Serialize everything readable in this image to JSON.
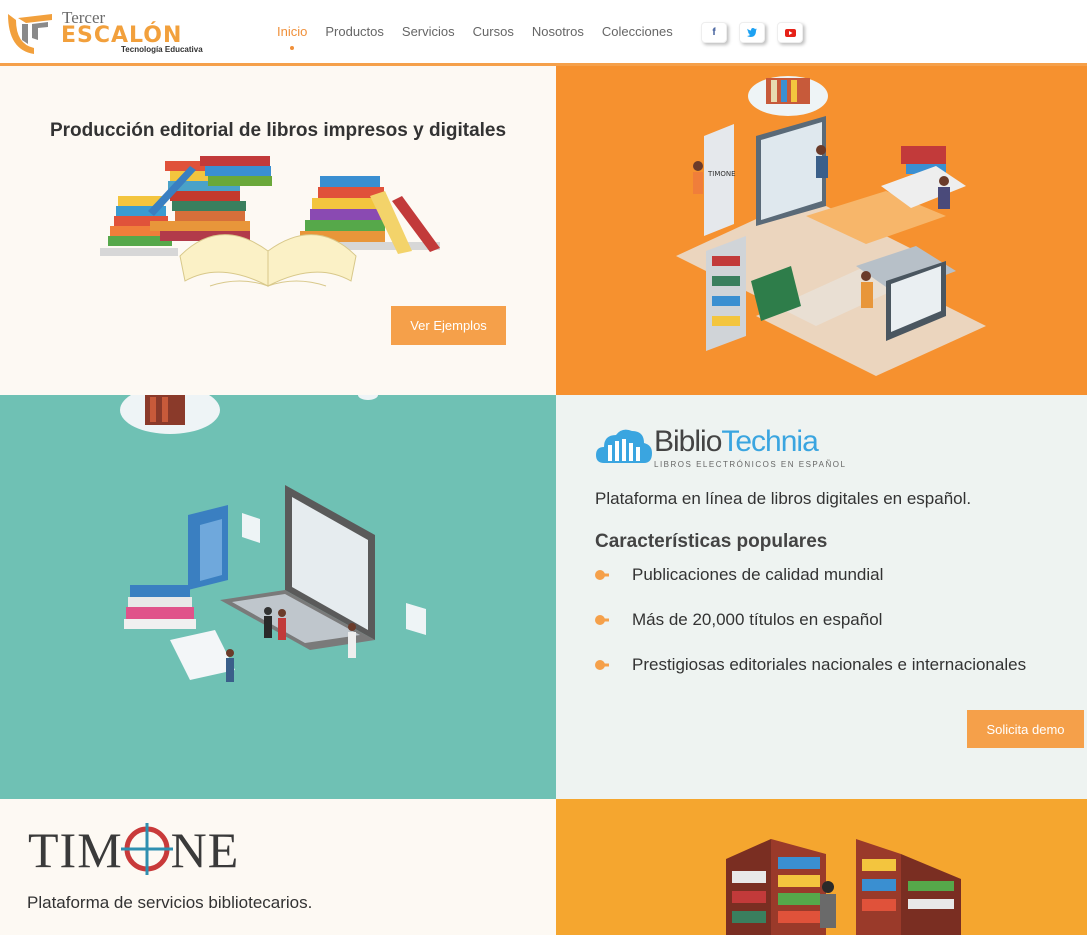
{
  "header": {
    "logo": {
      "top": "Tercer",
      "main": "ESCALÓN",
      "sub": "Tecnología Educativa"
    },
    "nav": [
      {
        "label": "Inicio",
        "active": true
      },
      {
        "label": "Productos",
        "active": false
      },
      {
        "label": "Servicios",
        "active": false
      },
      {
        "label": "Cursos",
        "active": false
      },
      {
        "label": "Nosotros",
        "active": false
      },
      {
        "label": "Colecciones",
        "active": false
      }
    ],
    "social": [
      {
        "icon": "facebook-icon",
        "glyph": "f",
        "color": "#3b5998"
      },
      {
        "icon": "twitter-icon",
        "glyph": "t",
        "color": "#1da1f2"
      },
      {
        "icon": "youtube-icon",
        "glyph": "▶",
        "color": "#e62117"
      }
    ]
  },
  "editorial": {
    "title": "Producción editorial de libros impresos y digitales",
    "button": "Ver Ejemplos"
  },
  "illustration_timone": {
    "screen_text": "TIMONE"
  },
  "bibliotechnia": {
    "logo_part1": "Biblio",
    "logo_part2": "Technia",
    "logo_sub": "LIBROS ELECTRÓNICOS EN ESPAÑOL",
    "lead": "Plataforma en línea de libros digitales en español.",
    "features_title": "Características populares",
    "features": [
      "Publicaciones de calidad mundial",
      "Más de 20,000 títulos en español",
      "Prestigiosas editoriales nacionales e internacionales"
    ],
    "button": "Solicita demo"
  },
  "timone": {
    "logo_left": "TIM",
    "logo_right": "NE",
    "lead": "Plataforma de servicios bibliotecarios."
  },
  "colors": {
    "accent": "#f5a04a",
    "orange_bg": "#f6912f",
    "teal_bg": "#6fc1b4",
    "cream_bg": "#fdf9f3",
    "light_bg": "#eef3f1"
  }
}
